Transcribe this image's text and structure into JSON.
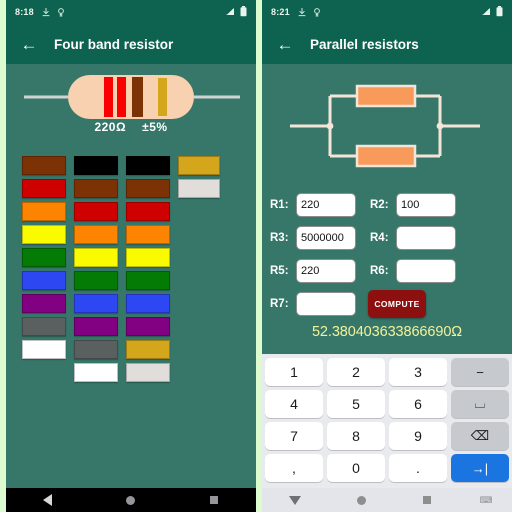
{
  "theme": {
    "page_background": "#ddfbd0",
    "app_bar": "#0d6350",
    "content_background": "#37776a",
    "result_text": "#f2f29a",
    "compute_button": "#8d1010",
    "keyboard_accent": "#1b75e0"
  },
  "left_phone": {
    "status": {
      "time": "8:18",
      "icons": [
        "download-icon",
        "vpn-key-icon"
      ],
      "right_icons": [
        "signal-icon",
        "battery-icon"
      ]
    },
    "appbar": {
      "back_label": "←",
      "title": "Four band resistor"
    },
    "resistor": {
      "value_label": "220Ω",
      "tolerance_label": "±5%",
      "body_color": "#f8d2b0",
      "lead_color": "#cfd4d3",
      "bands": [
        {
          "name": "red",
          "color": "#fb0000"
        },
        {
          "name": "red",
          "color": "#fb0000"
        },
        {
          "name": "brown",
          "color": "#7c3205"
        },
        {
          "name": "gold",
          "color": "#d3a61c"
        }
      ]
    },
    "swatch_grid": {
      "columns": [
        {
          "name": "band-1-digit",
          "swatches": [
            {
              "name": "brown",
              "color": "#7c3205"
            },
            {
              "name": "red",
              "color": "#ce0000"
            },
            {
              "name": "orange",
              "color": "#fd8400"
            },
            {
              "name": "yellow",
              "color": "#fbfb00"
            },
            {
              "name": "green",
              "color": "#047b04"
            },
            {
              "name": "blue",
              "color": "#2d47f2"
            },
            {
              "name": "violet",
              "color": "#820082"
            },
            {
              "name": "grey",
              "color": "#5a6060"
            },
            {
              "name": "white",
              "color": "#ffffff"
            }
          ]
        },
        {
          "name": "band-2-digit",
          "swatches": [
            {
              "name": "black",
              "color": "#000000"
            },
            {
              "name": "brown",
              "color": "#7c3205"
            },
            {
              "name": "red",
              "color": "#ce0000"
            },
            {
              "name": "orange",
              "color": "#fd8400"
            },
            {
              "name": "yellow",
              "color": "#fbfb00"
            },
            {
              "name": "green",
              "color": "#047b04"
            },
            {
              "name": "blue",
              "color": "#2d47f2"
            },
            {
              "name": "violet",
              "color": "#820082"
            },
            {
              "name": "grey",
              "color": "#5a6060"
            },
            {
              "name": "white",
              "color": "#ffffff"
            }
          ]
        },
        {
          "name": "band-3-multiplier",
          "swatches": [
            {
              "name": "black",
              "color": "#000000"
            },
            {
              "name": "brown",
              "color": "#7c3205"
            },
            {
              "name": "red",
              "color": "#ce0000"
            },
            {
              "name": "orange",
              "color": "#fd8400"
            },
            {
              "name": "yellow",
              "color": "#fbfb00"
            },
            {
              "name": "green",
              "color": "#047b04"
            },
            {
              "name": "blue",
              "color": "#2d47f2"
            },
            {
              "name": "violet",
              "color": "#820082"
            },
            {
              "name": "gold",
              "color": "#d3a61c"
            },
            {
              "name": "silver",
              "color": "#e0ddda"
            }
          ]
        },
        {
          "name": "band-4-tolerance",
          "swatches": [
            {
              "name": "gold",
              "color": "#d3a61c"
            },
            {
              "name": "silver",
              "color": "#e0ddda"
            }
          ]
        }
      ]
    },
    "navbar": {
      "buttons": [
        "back-nav-icon",
        "home-nav-icon",
        "recents-nav-icon"
      ]
    }
  },
  "right_phone": {
    "status": {
      "time": "8:21",
      "icons": [
        "download-icon",
        "vpn-key-icon"
      ],
      "right_icons": [
        "signal-icon",
        "battery-icon"
      ]
    },
    "appbar": {
      "back_label": "←",
      "title": "Parallel resistors"
    },
    "circuit": {
      "resistor_fill": "#f79a5a",
      "wire_color": "#f3e6d8",
      "resistor_count": 2
    },
    "form": {
      "rows": [
        [
          {
            "label": "R1:",
            "value": "220",
            "name": "r1-input"
          },
          {
            "label": "R2:",
            "value": "100",
            "name": "r2-input"
          }
        ],
        [
          {
            "label": "R3:",
            "value": "5000000",
            "name": "r3-input"
          },
          {
            "label": "R4:",
            "value": "",
            "name": "r4-input"
          }
        ],
        [
          {
            "label": "R5:",
            "value": "220",
            "name": "r5-input"
          },
          {
            "label": "R6:",
            "value": "",
            "name": "r6-input"
          }
        ]
      ],
      "last_row": {
        "label": "R7:",
        "value": "",
        "name": "r7-input"
      },
      "compute_label": "COMPUTE",
      "result": "52.380403633866690Ω"
    },
    "keyboard": {
      "rows": [
        [
          {
            "label": "1",
            "kind": "num",
            "name": "key-1"
          },
          {
            "label": "2",
            "kind": "num",
            "name": "key-2"
          },
          {
            "label": "3",
            "kind": "num",
            "name": "key-3"
          },
          {
            "label": "−",
            "kind": "fn",
            "name": "key-minus"
          }
        ],
        [
          {
            "label": "4",
            "kind": "num",
            "name": "key-4"
          },
          {
            "label": "5",
            "kind": "num",
            "name": "key-5"
          },
          {
            "label": "6",
            "kind": "num",
            "name": "key-6"
          },
          {
            "label": "⌴",
            "kind": "fn",
            "name": "key-space"
          }
        ],
        [
          {
            "label": "7",
            "kind": "num",
            "name": "key-7"
          },
          {
            "label": "8",
            "kind": "num",
            "name": "key-8"
          },
          {
            "label": "9",
            "kind": "num",
            "name": "key-9"
          },
          {
            "label": "⌫",
            "kind": "fn",
            "name": "key-backspace"
          }
        ],
        [
          {
            "label": ",",
            "kind": "num",
            "name": "key-comma"
          },
          {
            "label": "0",
            "kind": "num",
            "name": "key-0"
          },
          {
            "label": ".",
            "kind": "num",
            "name": "key-period"
          },
          {
            "label": "→|",
            "kind": "accent",
            "name": "key-next"
          }
        ]
      ]
    },
    "navbar": {
      "buttons": [
        "hide-keyboard-icon",
        "home-nav-icon",
        "recents-nav-icon",
        "keyboard-switch-icon"
      ]
    }
  }
}
